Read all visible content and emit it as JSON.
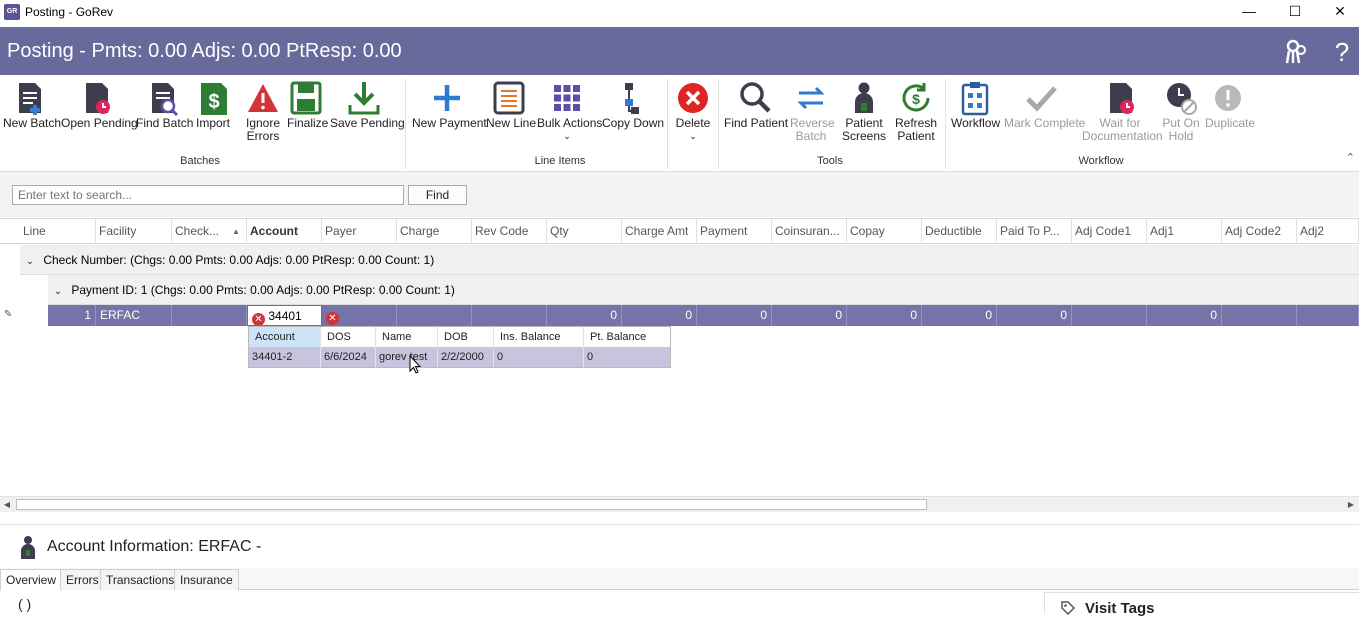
{
  "window": {
    "title": "Posting - GoRev",
    "app_icon": "GR",
    "minimize": "—",
    "maximize": "☐",
    "close": "✕"
  },
  "header": {
    "title": "Posting - Pmts: 0.00 Adjs: 0.00 PtResp: 0.00",
    "accent": "#676a9b"
  },
  "ribbon": {
    "buttons": [
      {
        "label": "New Batch"
      },
      {
        "label": "Open Pending"
      },
      {
        "label": "Find Batch"
      },
      {
        "label": "Import"
      },
      {
        "label": "Ignore Errors",
        "l1": "Ignore",
        "l2": "Errors"
      },
      {
        "label": "Finalize"
      },
      {
        "label": "Save Pending"
      },
      {
        "label": "New Payment"
      },
      {
        "label": "New Line"
      },
      {
        "label": "Bulk Actions"
      },
      {
        "label": "Copy Down"
      },
      {
        "label": "Delete"
      },
      {
        "label": "Find Patient"
      },
      {
        "l1": "Reverse",
        "l2": "Batch"
      },
      {
        "l1": "Patient",
        "l2": "Screens"
      },
      {
        "l1": "Refresh",
        "l2": "Patient"
      },
      {
        "label": "Workflow"
      },
      {
        "label": "Mark Complete"
      },
      {
        "l1": "Wait for",
        "l2": "Documentation"
      },
      {
        "l1": "Put On",
        "l2": "Hold"
      },
      {
        "label": "Duplicate"
      }
    ],
    "groups": {
      "batches": "Batches",
      "line_items": "Line Items",
      "tools": "Tools",
      "workflow": "Workflow"
    }
  },
  "search": {
    "placeholder": "Enter text to search...",
    "find_label": "Find"
  },
  "grid": {
    "columns": [
      "Line",
      "Facility",
      "Check...",
      "Account",
      "Payer",
      "Charge",
      "Rev Code",
      "Qty",
      "Charge Amt",
      "Payment",
      "Coinsuran...",
      "Copay",
      "Deductible",
      "Paid To P...",
      "Adj Code1",
      "Adj1",
      "Adj Code2",
      "Adj2"
    ],
    "group1": {
      "label": "Check Number:",
      "summary": "(Chgs: 0.00 Pmts: 0.00 Adjs: 0.00 PtResp: 0.00 Count: 1)"
    },
    "group2": {
      "label": "Payment ID: 1",
      "summary": "(Chgs: 0.00 Pmts: 0.00 Adjs: 0.00 PtResp: 0.00 Count: 1)"
    },
    "row": {
      "line": "1",
      "facility": "ERFAC",
      "account": "34401",
      "qty": "0",
      "charge_amt": "0",
      "payment": "0",
      "coinsurance": "0",
      "copay": "0",
      "deductible": "0",
      "paid_to_p": "0",
      "adj1": "0"
    }
  },
  "lookup": {
    "headers": [
      "Account",
      "DOS",
      "Name",
      "DOB",
      "Ins. Balance",
      "Pt. Balance"
    ],
    "row": [
      "34401-2",
      "6/6/2024",
      "gorev test",
      "2/2/2000",
      "0",
      "0"
    ]
  },
  "account_info": {
    "title": "Account Information: ERFAC -"
  },
  "tabs": [
    "Overview",
    "Errors",
    "Transactions",
    "Insurance"
  ],
  "overview": {
    "placeholder": "(   )"
  },
  "visit_tags": {
    "title": "Visit Tags"
  }
}
